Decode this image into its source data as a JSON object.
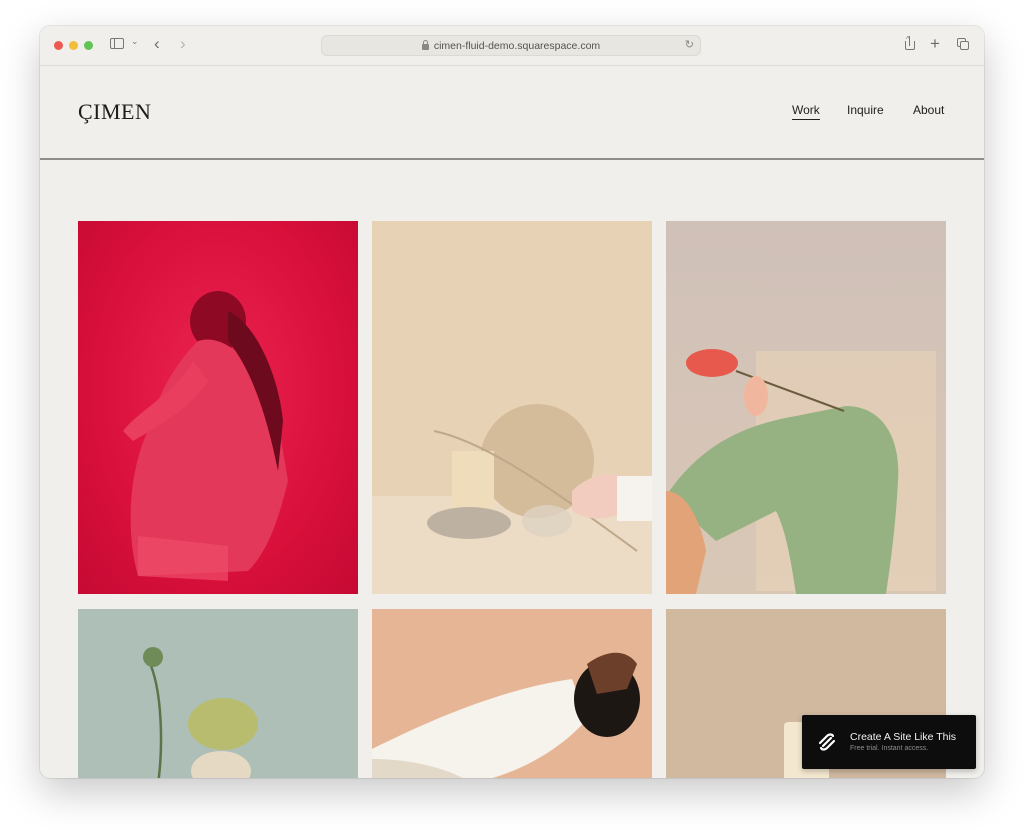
{
  "browser": {
    "url": "cimen-fluid-demo.squarespace.com",
    "icons": [
      "close-light",
      "minimize-light",
      "maximize-light",
      "sidebar-icon",
      "chevron-down-icon",
      "back-icon",
      "forward-icon",
      "lock-icon",
      "reload-icon",
      "share-icon",
      "new-tab-icon",
      "tab-overview-icon"
    ]
  },
  "site": {
    "logo": "ÇIMEN",
    "nav": [
      {
        "label": "Work",
        "active": true
      },
      {
        "label": "Inquire",
        "active": false
      },
      {
        "label": "About",
        "active": false
      }
    ]
  },
  "gallery": {
    "tiles": [
      {
        "description": "woman crouching, red background",
        "color": "#d9103b"
      },
      {
        "description": "soap bar on stone with dried grass, beige background",
        "color": "#e8d2b6"
      },
      {
        "description": "woman in green jumpsuit bending back with anthurium flower",
        "color": "#d5c4b7"
      },
      {
        "description": "prickly pear and plant stem, sage background",
        "color": "#aebfb8"
      },
      {
        "description": "man in white shirt leaning back, peach background",
        "color": "#e6b596"
      },
      {
        "description": "glass of milk, tan background",
        "color": "#d1b9a0"
      }
    ]
  },
  "promo": {
    "title": "Create A Site Like This",
    "subtitle": "Free trial. Instant access.",
    "icon": "squarespace-logo-icon"
  }
}
